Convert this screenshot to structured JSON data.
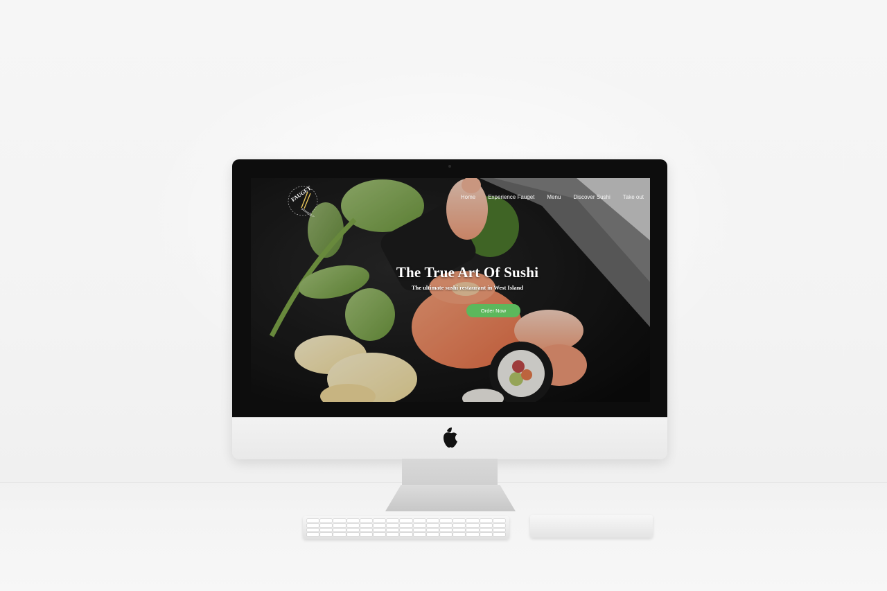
{
  "site": {
    "logo": {
      "text": "FAUGET",
      "tagline": "JAPANESE SUSHI"
    },
    "nav": {
      "items": [
        {
          "label": "Home"
        },
        {
          "label": "Experience Fauget"
        },
        {
          "label": "Menu"
        },
        {
          "label": "Discover Sushi"
        },
        {
          "label": "Take out"
        }
      ]
    },
    "hero": {
      "title": "The True Art Of Sushi",
      "subtitle": "The ultimate sushi restaurant in West Island",
      "cta_label": "Order Now"
    }
  },
  "icons": {
    "device_logo": "apple-logo-icon",
    "brand_mark": "chopsticks-icon"
  },
  "colors": {
    "cta": "#5cb85c",
    "screen_bg": "#121212",
    "nav_text": "#f4f4f4",
    "hero_text": "#ffffff"
  }
}
